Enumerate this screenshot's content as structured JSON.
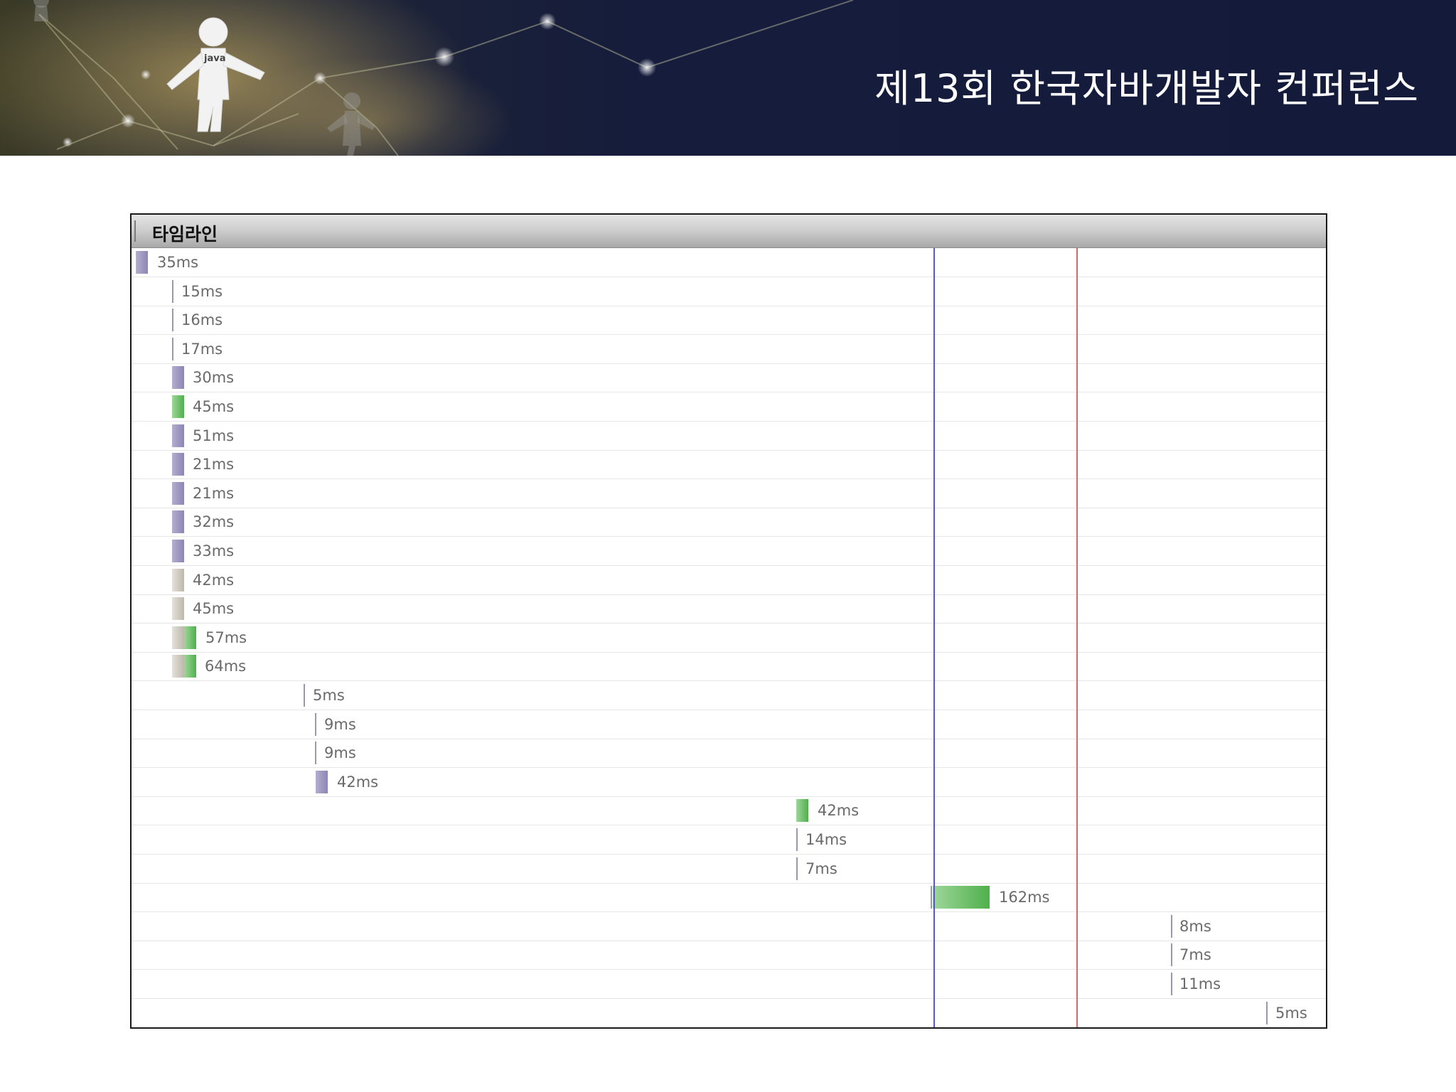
{
  "banner": {
    "title": "제13회 한국자바개발자 컨퍼런스",
    "logo_text": "java",
    "colors": {
      "sky": "#151c3c",
      "glow": "#4a4a2a"
    }
  },
  "panel": {
    "title": "타임라인",
    "colors": {
      "purple": "#9b94c0",
      "green": "#5cba58",
      "gray": "#cfcbc2",
      "blue_marker": "#5858cc",
      "red_marker": "#d46a6a"
    },
    "markers": [
      {
        "name": "blue-marker",
        "color": "#5858cc"
      },
      {
        "name": "red-marker",
        "color": "#d46a6a"
      }
    ],
    "rows": [
      {
        "label": "35ms"
      },
      {
        "label": "15ms"
      },
      {
        "label": "16ms"
      },
      {
        "label": "17ms"
      },
      {
        "label": "30ms"
      },
      {
        "label": "45ms"
      },
      {
        "label": "51ms"
      },
      {
        "label": "21ms"
      },
      {
        "label": "21ms"
      },
      {
        "label": "32ms"
      },
      {
        "label": "33ms"
      },
      {
        "label": "42ms"
      },
      {
        "label": "45ms"
      },
      {
        "label": "57ms"
      },
      {
        "label": "64ms"
      },
      {
        "label": "5ms"
      },
      {
        "label": "9ms"
      },
      {
        "label": "9ms"
      },
      {
        "label": "42ms"
      },
      {
        "label": "42ms"
      },
      {
        "label": "14ms"
      },
      {
        "label": "7ms"
      },
      {
        "label": "162ms"
      },
      {
        "label": "8ms"
      },
      {
        "label": "7ms"
      },
      {
        "label": "11ms"
      },
      {
        "label": "5ms"
      }
    ]
  }
}
